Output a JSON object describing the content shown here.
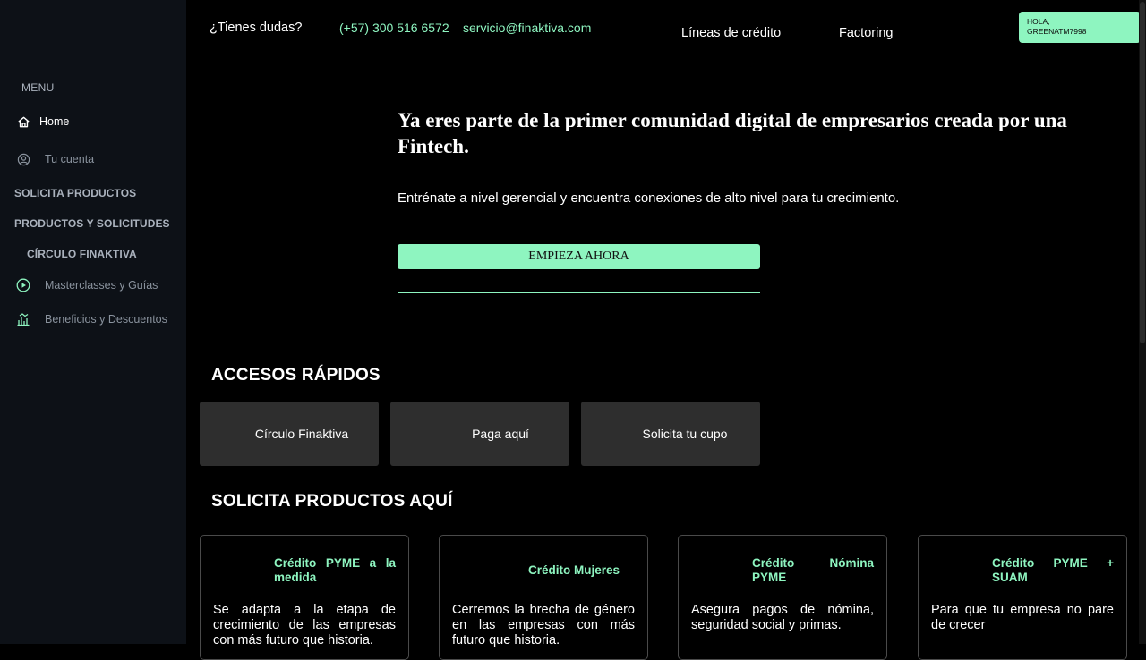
{
  "sidebar": {
    "menu_title": "MENU",
    "home": "Home",
    "account": "Tu cuenta",
    "section_request": "SOLICITA PRODUCTOS",
    "section_products": "PRODUCTOS Y SOLICITUDES",
    "section_circle": "CÍRCULO FINAKTIVA",
    "masterclasses": "Masterclasses y Guías",
    "benefits": "Beneficios y Descuentos"
  },
  "header": {
    "question": "¿Tienes dudas?",
    "phone": "(+57) 300 516 6572",
    "email": "servicio@finaktiva.com",
    "nav_credit_lines": "Líneas de crédito",
    "nav_factoring": "Factoring",
    "greeting": "HOLA,",
    "username": "GREENATM7998"
  },
  "hero": {
    "title": "Ya eres parte de la primer comunidad digital de empresarios creada por una Fintech.",
    "subtitle": "Entrénate a nivel gerencial y encuentra conexiones de alto nivel para tu crecimiento.",
    "cta_label": "EMPIEZA AHORA"
  },
  "quick_access": {
    "title": "ACCESOS RÁPIDOS",
    "items": [
      "Círculo Finaktiva",
      "Paga aquí",
      "Solicita tu cupo"
    ]
  },
  "products": {
    "title": "SOLICITA PRODUCTOS AQUÍ",
    "cards": [
      {
        "title": "Crédito PYME a la medida",
        "description": "Se adapta a la etapa de crecimiento de las empresas con más futuro que historia."
      },
      {
        "title": "Crédito Mujeres",
        "description": "Cerremos la brecha de género en las empresas con más futuro que historia."
      },
      {
        "title": "Crédito Nómina PYME",
        "description": "Asegura pagos de nómina, seguridad social y primas."
      },
      {
        "title": "Crédito PYME + SUAM",
        "description": "Para que tu empresa no pare de crecer"
      }
    ]
  },
  "colors": {
    "accent": "#8ef5c0",
    "sidebar_bg": "#0d1117",
    "page_bg": "#000000",
    "card_bg": "#2e2e2e"
  },
  "icons": [
    "home-icon",
    "user-circle-icon",
    "play-circle-icon",
    "benefits-chart-icon"
  ]
}
